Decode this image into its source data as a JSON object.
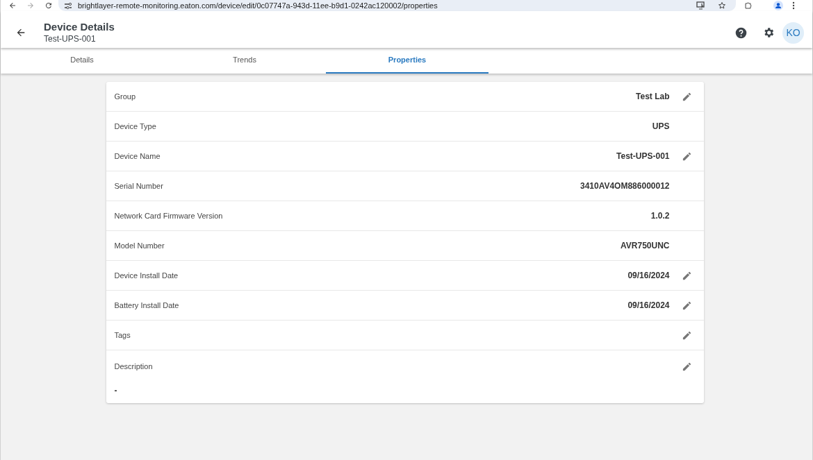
{
  "browser": {
    "url": "brightlayer-remote-monitoring.eaton.com/device/edit/0c07747a-943d-11ee-b9d1-0242ac120002/properties"
  },
  "header": {
    "title": "Device Details",
    "subtitle": "Test-UPS-001",
    "avatar": "KO"
  },
  "tabs": [
    {
      "label": "Details",
      "selected": false
    },
    {
      "label": "Trends",
      "selected": false
    },
    {
      "label": "Properties",
      "selected": true
    }
  ],
  "properties": [
    {
      "label": "Group",
      "value": "Test Lab",
      "editable": true,
      "kind": "inline"
    },
    {
      "label": "Device Type",
      "value": "UPS",
      "editable": false,
      "kind": "inline"
    },
    {
      "label": "Device Name",
      "value": "Test-UPS-001",
      "editable": true,
      "kind": "inline"
    },
    {
      "label": "Serial Number",
      "value": "3410AV4OM886000012",
      "editable": false,
      "kind": "inline"
    },
    {
      "label": "Network Card Firmware Version",
      "value": "1.0.2",
      "editable": false,
      "kind": "inline"
    },
    {
      "label": "Model Number",
      "value": "AVR750UNC",
      "editable": false,
      "kind": "inline"
    },
    {
      "label": "Device Install Date",
      "value": "09/16/2024",
      "editable": true,
      "kind": "inline"
    },
    {
      "label": "Battery Install Date",
      "value": "09/16/2024",
      "editable": true,
      "kind": "inline"
    },
    {
      "label": "Tags",
      "editable": true,
      "kind": "inline"
    },
    {
      "label": "Description",
      "value": "-",
      "editable": true,
      "kind": "block"
    }
  ]
}
